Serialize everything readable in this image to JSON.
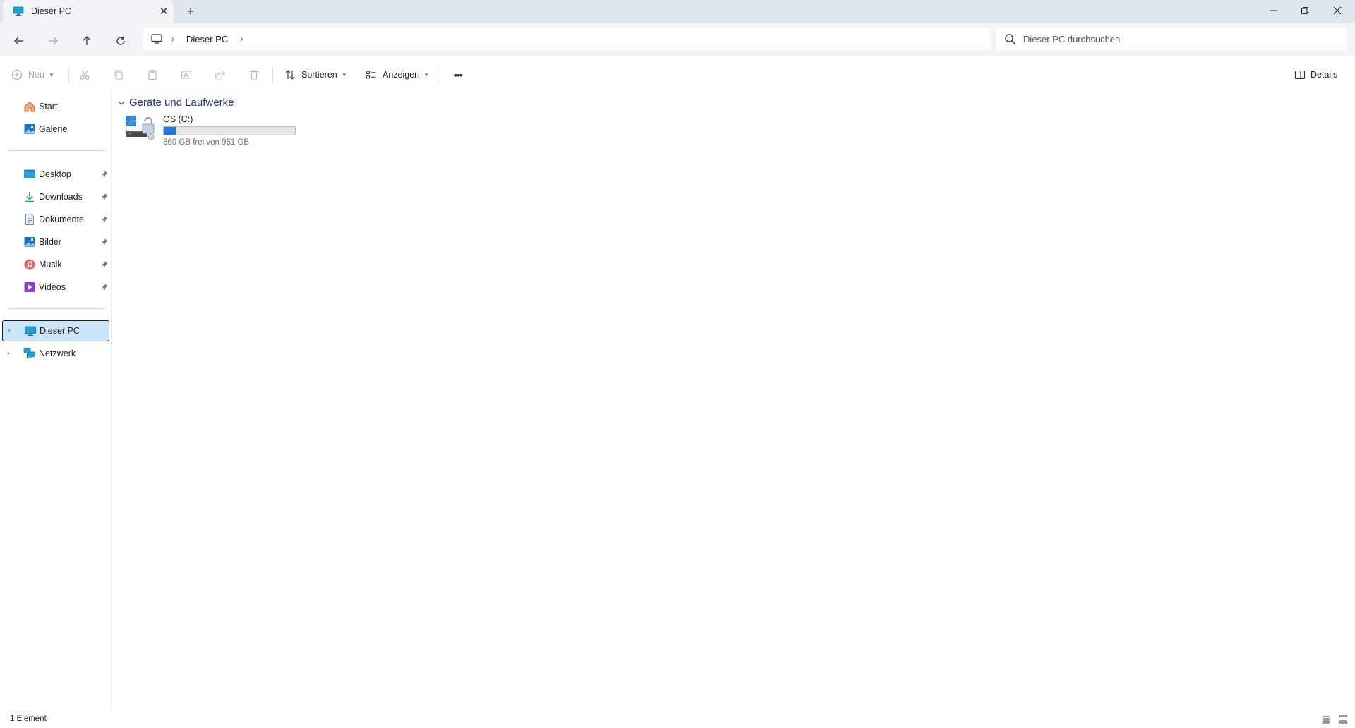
{
  "window": {
    "tab_title": "Dieser PC",
    "new_tab_label": "+",
    "controls": {
      "minimize": "—",
      "maximize": "❐",
      "close": "✕"
    }
  },
  "address": {
    "breadcrumb": [
      "Dieser PC"
    ],
    "search_placeholder": "Dieser PC durchsuchen"
  },
  "toolbar": {
    "new_label": "Neu",
    "sort_label": "Sortieren",
    "view_label": "Anzeigen",
    "more_label": "•••",
    "details_label": "Details"
  },
  "sidebar": {
    "quick": [
      {
        "label": "Start",
        "icon": "home-icon"
      },
      {
        "label": "Galerie",
        "icon": "gallery-icon"
      }
    ],
    "pinned": [
      {
        "label": "Desktop",
        "icon": "desktop-folder-icon"
      },
      {
        "label": "Downloads",
        "icon": "downloads-folder-icon"
      },
      {
        "label": "Dokumente",
        "icon": "documents-folder-icon"
      },
      {
        "label": "Bilder",
        "icon": "pictures-folder-icon"
      },
      {
        "label": "Musik",
        "icon": "music-folder-icon"
      },
      {
        "label": "Videos",
        "icon": "videos-folder-icon"
      }
    ],
    "locations": [
      {
        "label": "Dieser PC",
        "icon": "this-pc-icon",
        "selected": true
      },
      {
        "label": "Netzwerk",
        "icon": "network-icon",
        "selected": false
      }
    ]
  },
  "main": {
    "group_title": "Geräte und Laufwerke",
    "drives": [
      {
        "name": "OS (C:)",
        "free_text": "860 GB frei von 951 GB",
        "used_fraction": 0.096
      }
    ]
  },
  "status": {
    "item_count": "1 Element"
  },
  "colors": {
    "accent": "#1f7ad4",
    "selection": "#cce4f7",
    "titlebar": "#dfe5ee"
  }
}
